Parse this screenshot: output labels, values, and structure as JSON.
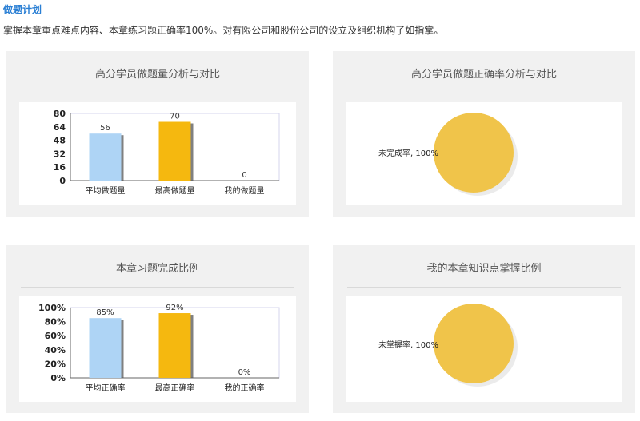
{
  "page": {
    "title": "做题计划",
    "description": "掌握本章重点难点内容、本章练习题正确率100%。对有限公司和股份公司的设立及组织机构了如指掌。"
  },
  "panels": [
    {
      "title": "高分学员做题量分析与对比"
    },
    {
      "title": "高分学员做题正确率分析与对比"
    },
    {
      "title": "本章习题完成比例"
    },
    {
      "title": "我的本章知识点掌握比例"
    }
  ],
  "colors": {
    "bar_light_blue": "#aed4f5",
    "bar_orange": "#f5b80f",
    "pie_yellow": "#f0c44a",
    "title_blue": "#2a7fd4"
  },
  "chart_data": [
    {
      "type": "bar",
      "categories": [
        "平均做题量",
        "最高做题量",
        "我的做题量"
      ],
      "values": [
        56,
        70,
        0
      ],
      "value_labels": [
        "56",
        "70",
        "0"
      ],
      "yticks": [
        "0",
        "16",
        "32",
        "48",
        "64",
        "80"
      ],
      "ylim": [
        0,
        80
      ],
      "colors": [
        "#aed4f5",
        "#f5b80f",
        "#aed4f5"
      ]
    },
    {
      "type": "pie",
      "labels": [
        "未完成率"
      ],
      "values": [
        100
      ],
      "slice_labels": [
        "未完成率, 100%"
      ],
      "colors": [
        "#f0c44a"
      ]
    },
    {
      "type": "bar",
      "categories": [
        "平均正确率",
        "最高正确率",
        "我的正确率"
      ],
      "values": [
        85,
        92,
        0
      ],
      "value_labels": [
        "85%",
        "92%",
        "0%"
      ],
      "yticks": [
        "0%",
        "20%",
        "40%",
        "60%",
        "80%",
        "100%"
      ],
      "ylim": [
        0,
        100
      ],
      "colors": [
        "#aed4f5",
        "#f5b80f",
        "#aed4f5"
      ]
    },
    {
      "type": "pie",
      "labels": [
        "未掌握率"
      ],
      "values": [
        100
      ],
      "slice_labels": [
        "未掌握率, 100%"
      ],
      "colors": [
        "#f0c44a"
      ]
    }
  ]
}
